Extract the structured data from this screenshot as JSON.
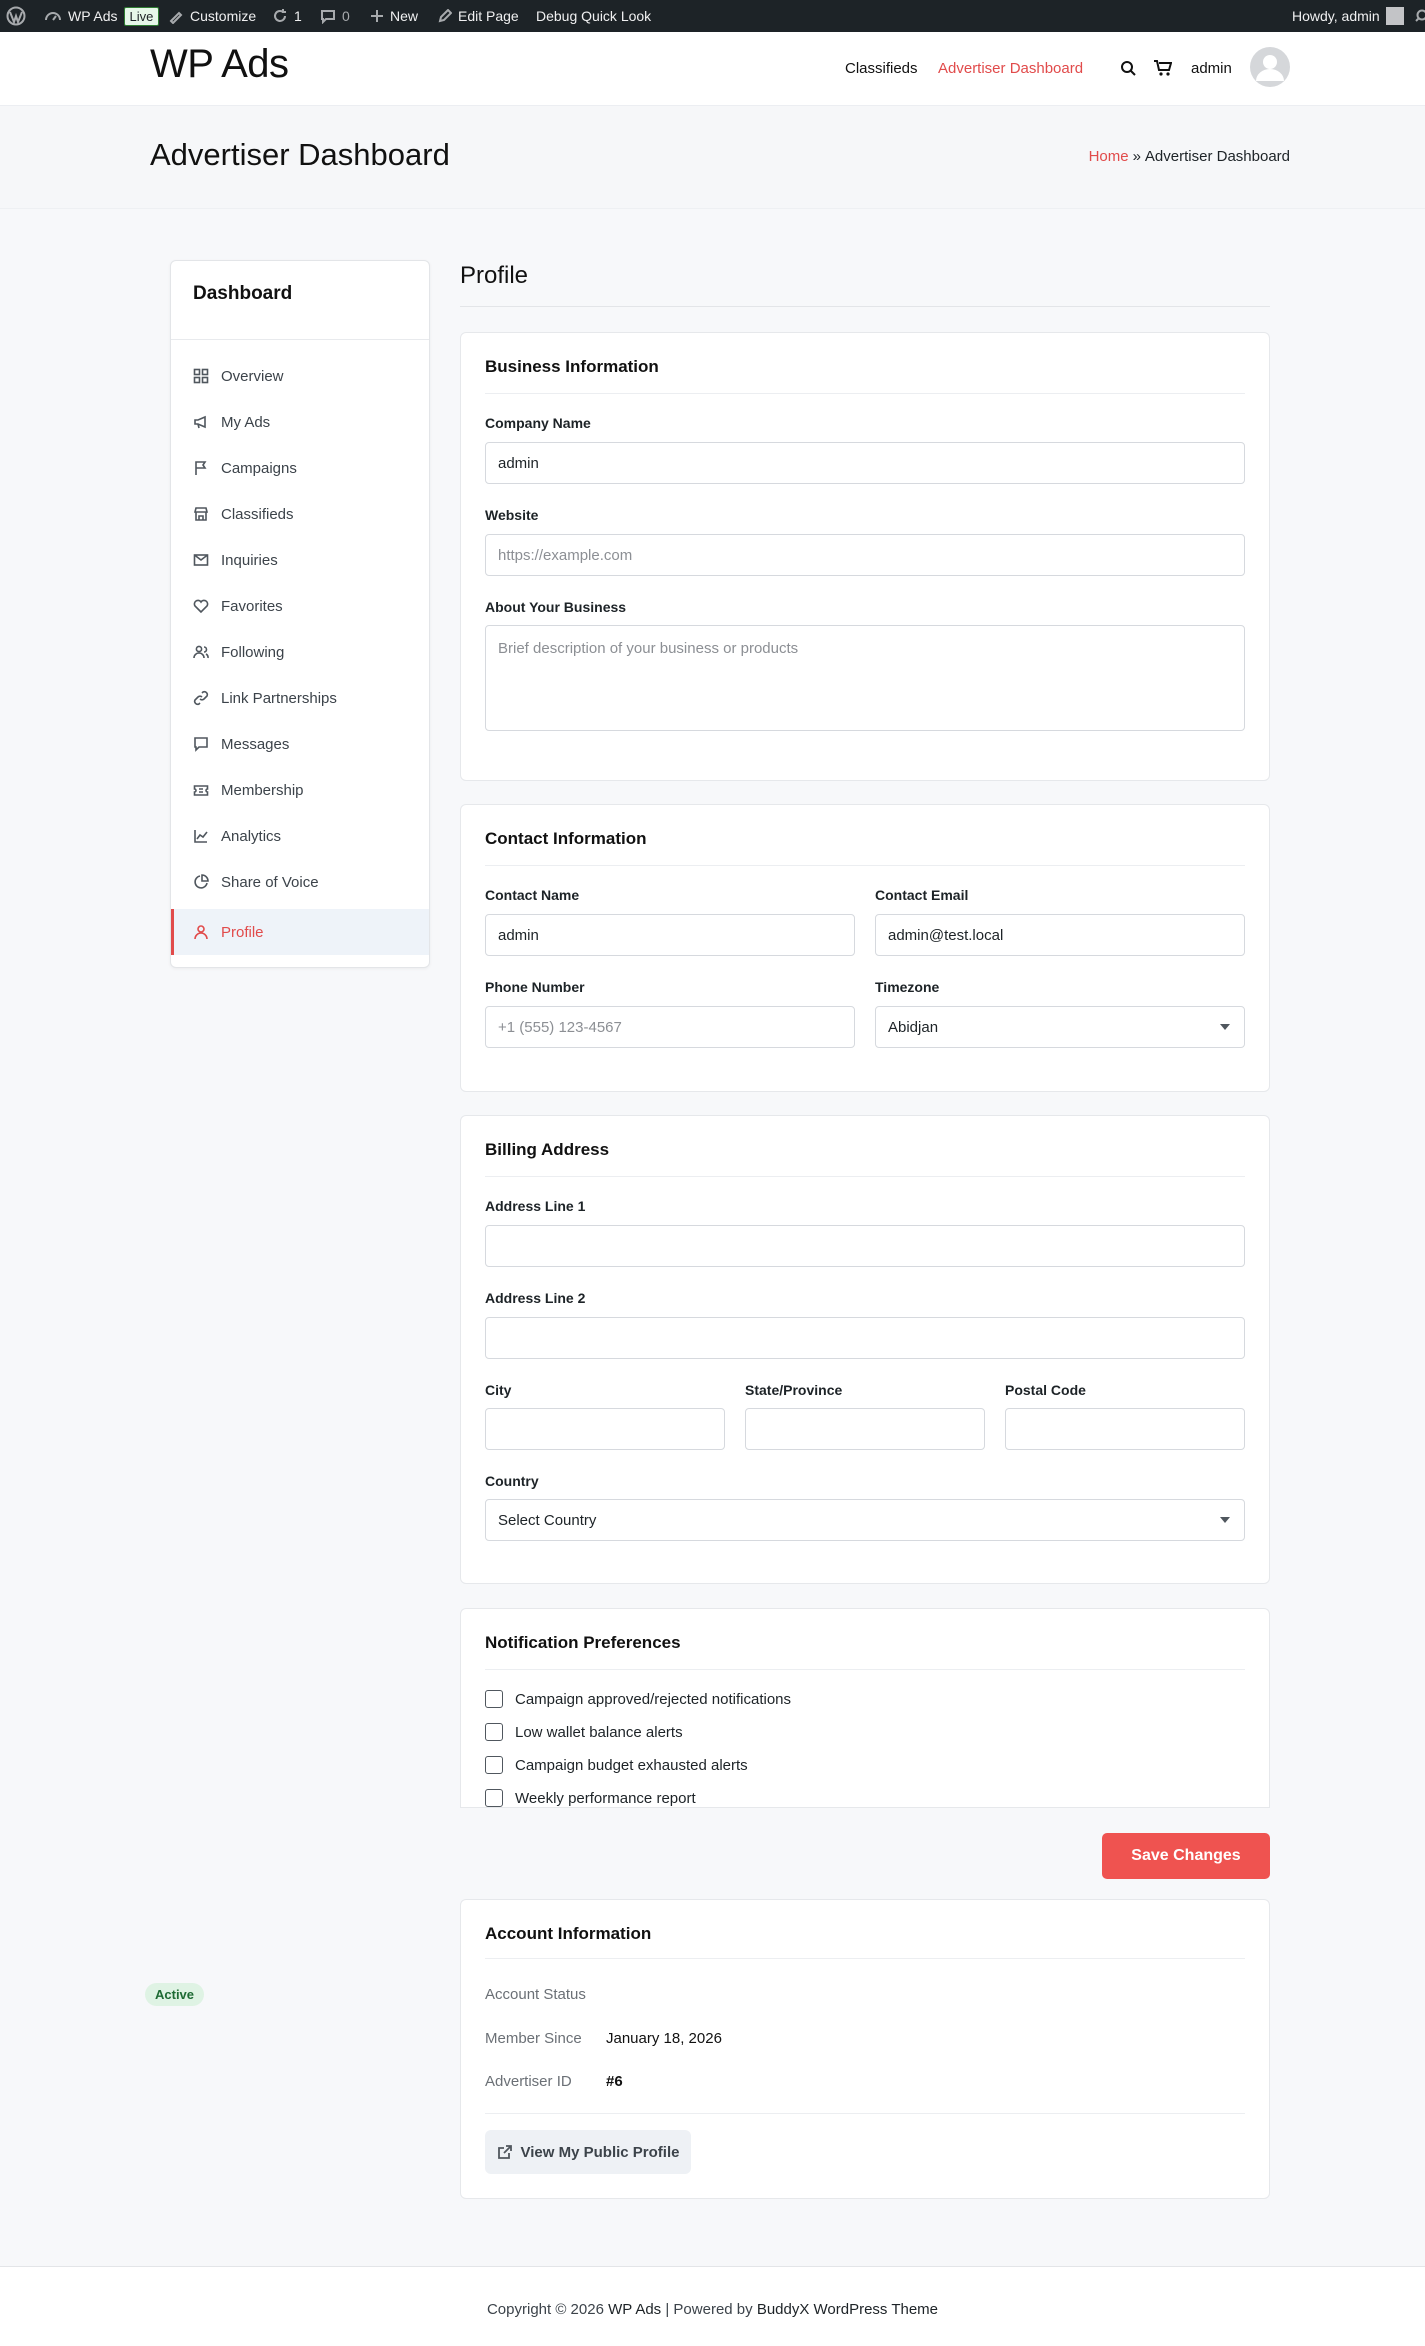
{
  "adminbar": {
    "wp_logo_icon": "wordpress-icon",
    "site_name": "WP Ads",
    "live_badge": "Live",
    "customize": "Customize",
    "updates_count": "1",
    "comments_count": "0",
    "new_label": "New",
    "edit_page": "Edit Page",
    "debug": "Debug Quick Look",
    "howdy": "Howdy, admin"
  },
  "header": {
    "logo": "WP Ads",
    "nav": [
      "Classifieds",
      "Advertiser Dashboard"
    ],
    "user": "admin",
    "accent": "#e14b4b"
  },
  "hero": {
    "title": "Advertiser Dashboard",
    "crumb_home": "Home",
    "crumb_sep": "»",
    "crumb_current": "Advertiser Dashboard"
  },
  "sidebar": {
    "title": "Dashboard",
    "items": [
      {
        "label": "Overview",
        "icon": "grid-icon"
      },
      {
        "label": "My Ads",
        "icon": "megaphone-icon"
      },
      {
        "label": "Campaigns",
        "icon": "flag-icon"
      },
      {
        "label": "Classifieds",
        "icon": "store-icon"
      },
      {
        "label": "Inquiries",
        "icon": "mail-icon"
      },
      {
        "label": "Favorites",
        "icon": "heart-icon"
      },
      {
        "label": "Following",
        "icon": "users-icon"
      },
      {
        "label": "Link Partnerships",
        "icon": "link-icon"
      },
      {
        "label": "Messages",
        "icon": "chat-icon"
      },
      {
        "label": "Membership",
        "icon": "ticket-icon"
      },
      {
        "label": "Analytics",
        "icon": "chart-icon"
      },
      {
        "label": "Share of Voice",
        "icon": "pie-icon"
      },
      {
        "label": "Profile",
        "icon": "user-icon",
        "active": true
      }
    ]
  },
  "profile": {
    "title": "Profile",
    "business": {
      "heading": "Business Information",
      "company_label": "Company Name",
      "company_value": "admin",
      "website_label": "Website",
      "website_placeholder": "https://example.com",
      "about_label": "About Your Business",
      "about_placeholder": "Brief description of your business or products"
    },
    "contact": {
      "heading": "Contact Information",
      "name_label": "Contact Name",
      "name_value": "admin",
      "email_label": "Contact Email",
      "email_value": "admin@test.local",
      "phone_label": "Phone Number",
      "phone_placeholder": "+1 (555) 123-4567",
      "tz_label": "Timezone",
      "tz_value": "Abidjan"
    },
    "billing": {
      "heading": "Billing Address",
      "addr1_label": "Address Line 1",
      "addr2_label": "Address Line 2",
      "city_label": "City",
      "state_label": "State/Province",
      "postal_label": "Postal Code",
      "country_label": "Country",
      "country_value": "Select Country"
    },
    "notifications": {
      "heading": "Notification Preferences",
      "items": [
        "Campaign approved/rejected notifications",
        "Low wallet balance alerts",
        "Campaign budget exhausted alerts",
        "Weekly performance report"
      ]
    },
    "save_label": "Save Changes",
    "account": {
      "heading": "Account Information",
      "status_label": "Account Status",
      "status_value": "Active",
      "since_label": "Member Since",
      "since_value": "January 18, 2026",
      "id_label": "Advertiser ID",
      "id_value": "#6",
      "public_btn": "View My Public Profile"
    }
  },
  "footer": {
    "copyright": "Copyright © 2026",
    "site": "WP Ads",
    "powered": "| Powered by",
    "theme": "BuddyX WordPress Theme"
  }
}
